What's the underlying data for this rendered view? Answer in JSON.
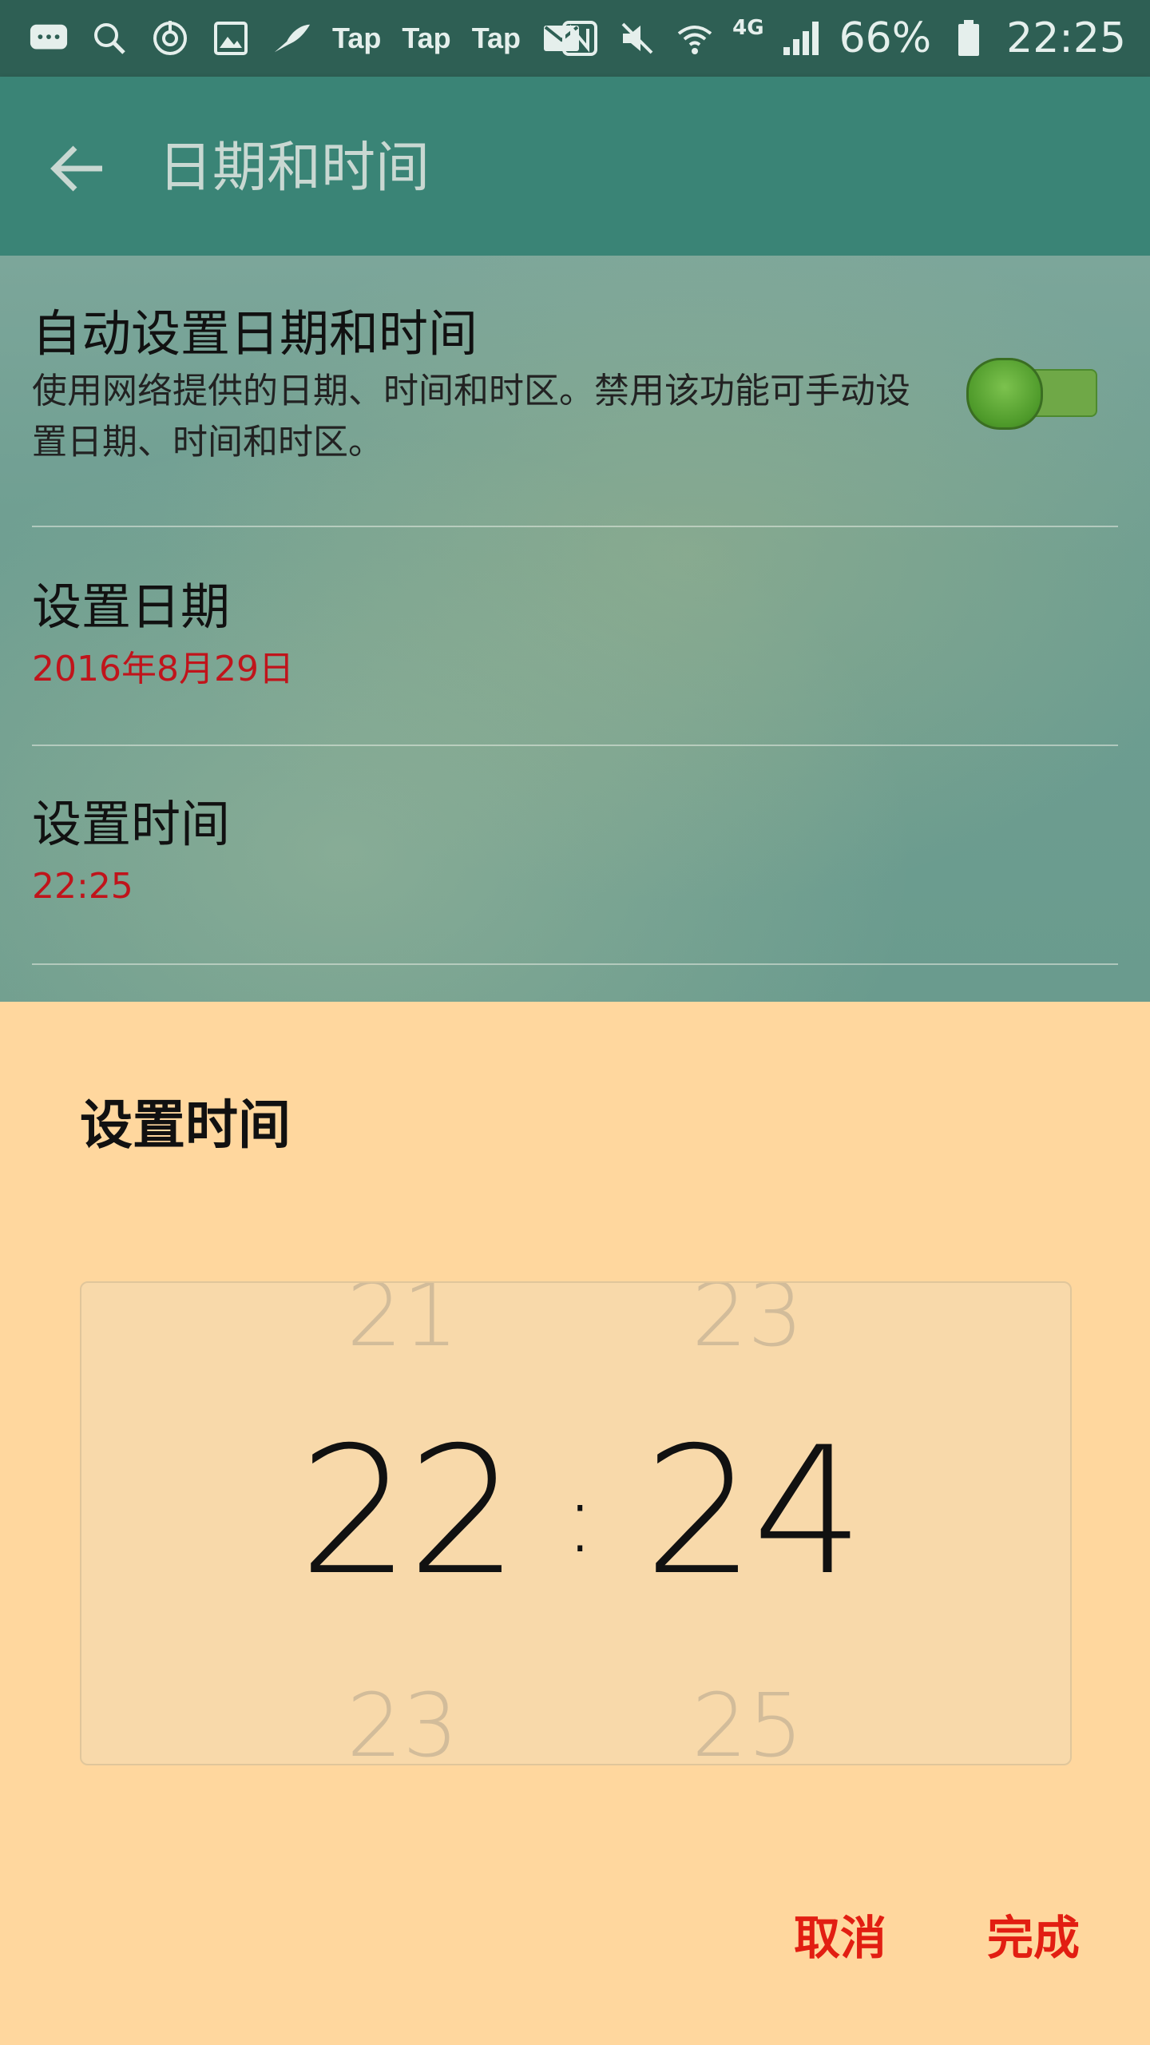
{
  "status_bar": {
    "tap1": "Tap",
    "tap2": "Tap",
    "tap3": "Tap",
    "network": "4G",
    "battery": "66%",
    "time": "22:25"
  },
  "app_bar": {
    "title": "日期和时间"
  },
  "settings": {
    "auto": {
      "title": "自动设置日期和时间",
      "description": "使用网络提供的日期、时间和时区。禁用该功能可手动设置日期、时间和时区。",
      "enabled": true
    },
    "date": {
      "title": "设置日期",
      "value": "2016年8月29日"
    },
    "time": {
      "title": "设置时间",
      "value": "22:25"
    }
  },
  "dialog": {
    "title": "设置时间",
    "picker": {
      "hour_prev": "21",
      "hour": "22",
      "hour_next": "23",
      "minute_prev": "23",
      "minute": "24",
      "minute_next": "25",
      "separator": ":"
    },
    "cancel_label": "取消",
    "done_label": "完成"
  },
  "colors": {
    "status_bar": "#2E5F54",
    "app_bar": "#3A8476",
    "dialog_bg": "#FFD79E",
    "value_red": "#C0141B",
    "button_red": "#E21E12",
    "toggle_green": "#6FA847"
  }
}
